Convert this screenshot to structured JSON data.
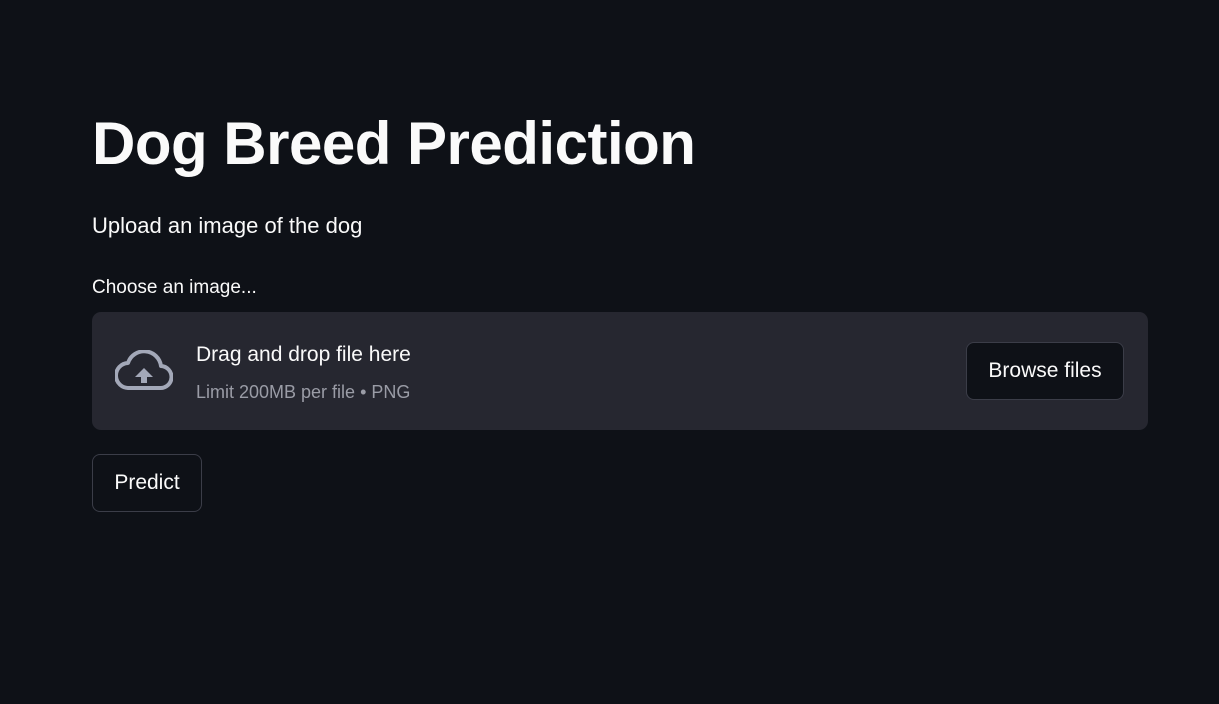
{
  "page": {
    "title": "Dog Breed Prediction",
    "subtitle": "Upload an image of the dog"
  },
  "uploader": {
    "label": "Choose an image...",
    "drop_title": "Drag and drop file here",
    "drop_limit": "Limit 200MB per file • PNG",
    "browse_label": "Browse files",
    "icon": "cloud-upload-icon"
  },
  "actions": {
    "predict_label": "Predict"
  },
  "colors": {
    "background": "#0e1117",
    "dropzone": "#262730",
    "text": "#fafafa",
    "muted_text": "#9a9ca6",
    "icon": "#a3a8b8"
  }
}
